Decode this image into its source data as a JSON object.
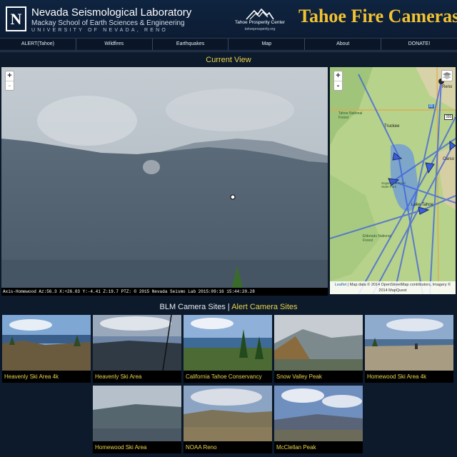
{
  "header": {
    "logo_letter": "N",
    "org_title": "Nevada Seismological Laboratory",
    "org_subtitle": "Mackay School of Earth Sciences & Engineering",
    "university": "UNIVERSITY OF NEVADA, RENO",
    "partner_name": "Tahoe Prosperity Center",
    "partner_url": "tahoeprosperity.org",
    "site_title": "Tahoe Fire Cameras"
  },
  "nav": {
    "items": [
      "ALERT(Tahoe)",
      "Wildfires",
      "Earthquakes",
      "Map",
      "About",
      "DONATE!"
    ]
  },
  "current_view": {
    "title": "Current View",
    "caption": "Axis-Homewood Az:56.3 X:+26.03 Y:-4.41 Z:19.7 PTZ: © 2015 Nevada Seismo Lab 2015:09:16 15:44:20.28",
    "zoom_in": "+",
    "zoom_out": "-"
  },
  "map": {
    "zoom_in": "+",
    "zoom_out": "-",
    "labels": {
      "reno": "Reno",
      "truckee": "Truckee",
      "carson": "Carso",
      "lake_tahoe": "Lake Tahoe",
      "forest": "Tahoe National Forest",
      "eldorado": "Eldorado National Forest",
      "sugar_pine": "Sugar Pine Point State Park",
      "route_80": "80",
      "route_395": "395"
    },
    "attribution_link": "Leaflet",
    "attribution": "| Map data © 2014 OpenStreetMap contributors, Imagery © 2014 MapQuest"
  },
  "sites": {
    "blm_label": "BLM Camera Sites",
    "separator": "|",
    "alert_label": "Alert Camera Sites",
    "cameras": [
      {
        "label": "Heavenly Ski Area 4k"
      },
      {
        "label": "Heavenly Ski Area"
      },
      {
        "label": "California Tahoe Conservancy"
      },
      {
        "label": "Snow Valley Peak"
      },
      {
        "label": "Homewood Ski Area 4k"
      },
      {
        "label": "Homewood Ski Area"
      },
      {
        "label": "NOAA Reno"
      },
      {
        "label": "McClellan Peak"
      }
    ]
  },
  "colors": {
    "background": "#0d1a2b",
    "title_gold": "#f1c232",
    "label_yellow": "#e8d34a",
    "camera_ray": "#3b5fe0"
  }
}
